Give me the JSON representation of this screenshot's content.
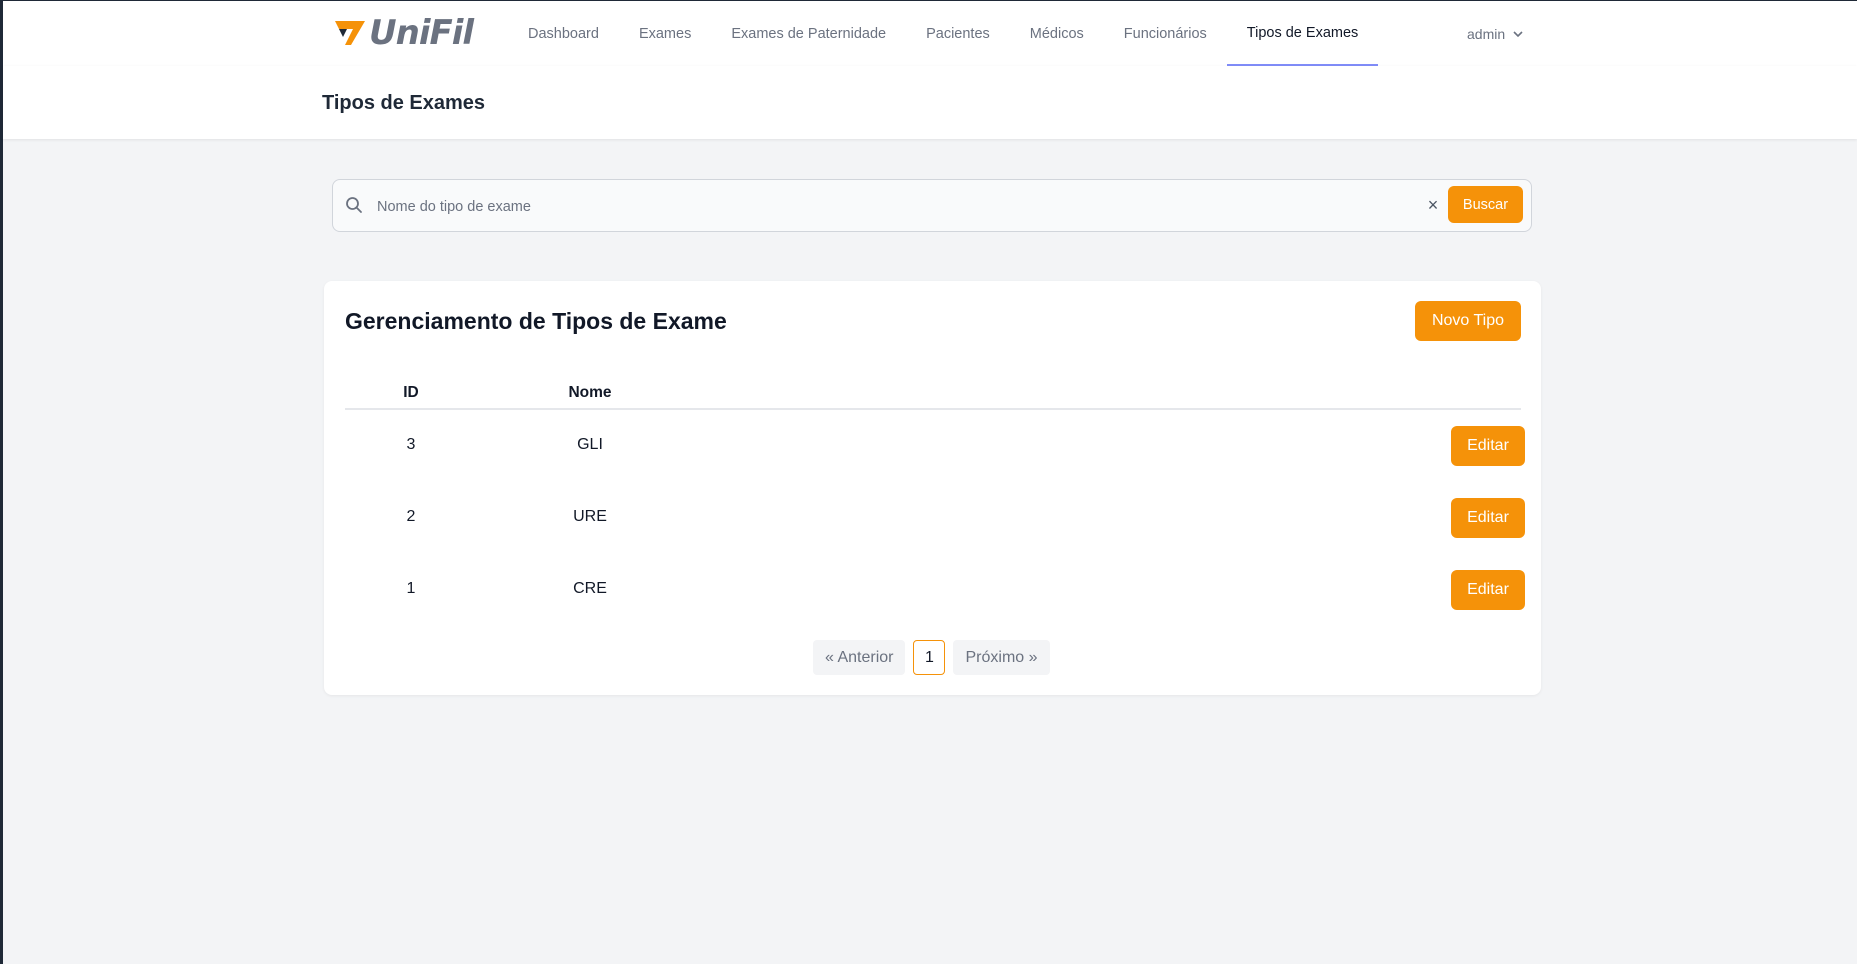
{
  "brand": {
    "name": "UniFil",
    "accent": "#f59209"
  },
  "nav": {
    "items": [
      {
        "label": "Dashboard"
      },
      {
        "label": "Exames"
      },
      {
        "label": "Exames de Paternidade"
      },
      {
        "label": "Pacientes"
      },
      {
        "label": "Médicos"
      },
      {
        "label": "Funcionários"
      },
      {
        "label": "Tipos de Exames"
      }
    ],
    "active": "Tipos de Exames",
    "user": "admin"
  },
  "header": {
    "title": "Tipos de Exames"
  },
  "search": {
    "placeholder": "Nome do tipo de exame",
    "value": "",
    "clear_label": "×",
    "button_label": "Buscar"
  },
  "card": {
    "title": "Gerenciamento de Tipos de Exame",
    "new_button_label": "Novo Tipo"
  },
  "table": {
    "columns": [
      "ID",
      "Nome"
    ],
    "rows": [
      {
        "id": "3",
        "nome": "GLI",
        "action": "Editar"
      },
      {
        "id": "2",
        "nome": "URE",
        "action": "Editar"
      },
      {
        "id": "1",
        "nome": "CRE",
        "action": "Editar"
      }
    ]
  },
  "pagination": {
    "prev_label": "« Anterior",
    "current_page": "1",
    "next_label": "Próximo »"
  }
}
